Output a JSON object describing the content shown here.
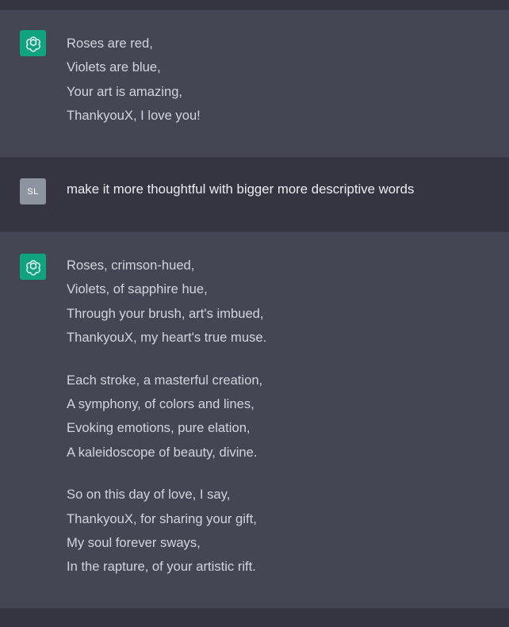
{
  "conversation": {
    "messages": [
      {
        "role": "assistant",
        "stanzas": [
          [
            "Roses are red,",
            "Violets are blue,",
            "Your art is amazing,",
            "ThankyouX, I love you!"
          ]
        ]
      },
      {
        "role": "user",
        "avatar_initials": "SL",
        "text": "make it more thoughtful with bigger more descriptive words"
      },
      {
        "role": "assistant",
        "stanzas": [
          [
            "Roses, crimson-hued,",
            "Violets, of sapphire hue,",
            "Through your brush, art's imbued,",
            "ThankyouX, my heart's true muse."
          ],
          [
            "Each stroke, a masterful creation,",
            "A symphony, of colors and lines,",
            "Evoking emotions, pure elation,",
            "A kaleidoscope of beauty, divine."
          ],
          [
            "So on this day of love, I say,",
            "ThankyouX, for sharing your gift,",
            "My soul forever sways,",
            "In the rapture, of your artistic rift."
          ]
        ]
      }
    ]
  },
  "colors": {
    "page_background": "#343541",
    "assistant_background": "#444654",
    "assistant_avatar": "#10a37f",
    "user_avatar": "#8c959f",
    "text": "#d1d5db"
  },
  "icons": {
    "assistant_avatar": "openai-logo-icon"
  }
}
